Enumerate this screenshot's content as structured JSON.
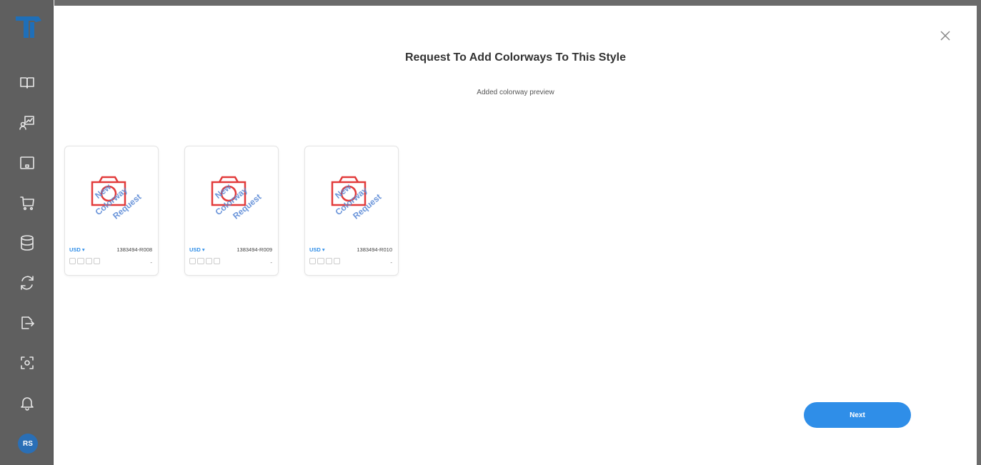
{
  "sidebar": {
    "avatar_initials": "RS",
    "icons": [
      "book-icon",
      "chart-user-icon",
      "window-icon",
      "cart-icon",
      "database-icon",
      "sync-icon",
      "export-icon",
      "scan-icon",
      "bell-icon"
    ]
  },
  "modal": {
    "title": "Request To Add Colorways To This Style",
    "subtitle": "Added colorway preview",
    "next_label": "Next"
  },
  "cards": [
    {
      "currency": "USD",
      "code": "1383494-R008",
      "dash": "-",
      "watermark": [
        "New",
        "Colorway",
        "Request"
      ]
    },
    {
      "currency": "USD",
      "code": "1383494-R009",
      "dash": "-",
      "watermark": [
        "New",
        "Colorway",
        "Request"
      ]
    },
    {
      "currency": "USD",
      "code": "1383494-R010",
      "dash": "-",
      "watermark": [
        "New",
        "Colorway",
        "Request"
      ]
    }
  ],
  "colors": {
    "accent": "#2f8ee8",
    "sidebar": "#5f5f5f",
    "camera": "#e23b3b",
    "watermark": "#5b8ad6"
  }
}
